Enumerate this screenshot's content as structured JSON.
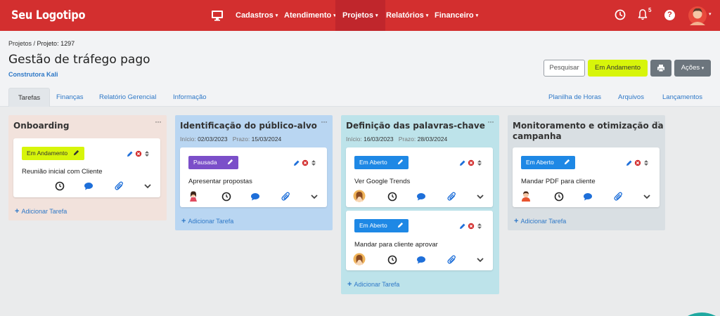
{
  "colors": {
    "navbar": "#d32f2f",
    "accent_link": "#2e78c7",
    "status_em_andamento": "#d7f50a",
    "status_pausada": "#7b4fc9",
    "status_em_aberto": "#1e88e5"
  },
  "navbar": {
    "logo": "Seu Logotipo",
    "items": [
      {
        "label": "Cadastros",
        "caret": "▾"
      },
      {
        "label": "Atendimento",
        "caret": "▾"
      },
      {
        "label": "Projetos",
        "caret": "▾"
      },
      {
        "label": "Relatórios",
        "caret": "▾"
      },
      {
        "label": "Financeiro",
        "caret": "▾"
      }
    ],
    "notifications_count": "5",
    "help_label": "?",
    "avatar_caret": "▾",
    "icons": [
      "desktop-icon",
      "clock-icon",
      "bell-icon",
      "help-icon",
      "user-avatar"
    ]
  },
  "header": {
    "breadcrumb_parent": "Projetos",
    "breadcrumb_sep": " / ",
    "breadcrumb_current": "Projeto: 1297",
    "title": "Gestão de tráfego pago",
    "client": "Construtora Kali",
    "search_label": "Pesquisar",
    "status_label": "Em Andamento",
    "actions_label": "Ações",
    "actions_caret": "▾"
  },
  "tabs": {
    "left": [
      "Tarefas",
      "Finanças",
      "Relatório Gerencial",
      "Informação"
    ],
    "right": [
      "Planilha de Horas",
      "Arquivos",
      "Lançamentos"
    ]
  },
  "board": {
    "menu_glyph": "···",
    "add_task_plus": "+",
    "add_task_label": "Adicionar Tarefa",
    "start_label": "Início:",
    "due_label": "Prazo:",
    "columns": [
      {
        "title": "Onboarding",
        "bg": "#f2e2dc",
        "tasks": [
          {
            "status": "Em Andamento",
            "name": "Reunião inicial com Cliente",
            "assignee": false
          }
        ]
      },
      {
        "title": "Identificação do público-alvo",
        "bg": "#b9d6f2",
        "start": "02/03/2023",
        "due": "15/03/2024",
        "tasks": [
          {
            "status": "Pausada",
            "name": "Apresentar propostas",
            "assignee": true
          }
        ]
      },
      {
        "title": "Definição das palavras-chave",
        "bg": "#bde3ea",
        "start": "16/03/2023",
        "due": "28/03/2024",
        "tasks": [
          {
            "status": "Em Aberto",
            "name": "Ver Google Trends",
            "assignee": true
          },
          {
            "status": "Em Aberto",
            "name": "Mandar para cliente aprovar",
            "assignee": true
          }
        ]
      },
      {
        "title_line1": "Monitoramento e otimização da",
        "title_line2": "campanha",
        "bg": "#d9dfe3",
        "tasks": [
          {
            "status": "Em Aberto",
            "name": "Mandar PDF para cliente",
            "assignee": true
          }
        ]
      }
    ]
  }
}
